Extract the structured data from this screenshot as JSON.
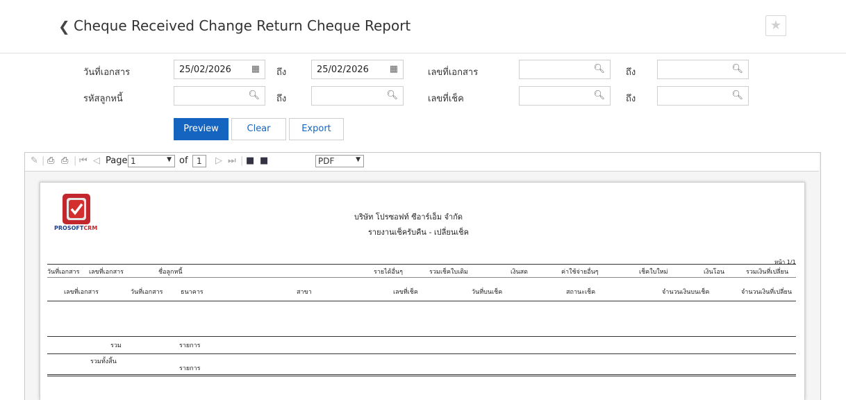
{
  "header": {
    "back_icon": "chevron-left-icon",
    "title": "Cheque Received Change Return Cheque Report",
    "star_icon": "star-icon"
  },
  "form": {
    "doc_date_label": "วันที่เอกสาร",
    "doc_date_from": "25/02/2026",
    "doc_date_to": "25/02/2026",
    "to_label": "ถึง",
    "doc_no_label": "เลขที่เอกสาร",
    "debtor_code_label": "รหัสลูกหนี้",
    "cheque_no_label": "เลขที่เช็ค",
    "calendar_icon": "calendar-icon",
    "search_icon": "search-icon"
  },
  "buttons": {
    "preview": "Preview",
    "clear": "Clear",
    "export": "Export"
  },
  "toolbar": {
    "page_label": "Page",
    "page_value": "1",
    "of_label": "of",
    "total_pages": "1",
    "format": "PDF"
  },
  "report": {
    "company": "บริษัท โปรซอฟท์ ซีอาร์เอ็ม จำกัด",
    "report_title": "รายงานเช็ครับคืน - เปลี่ยนเช็ค",
    "logo_text_a": "PROSOFT",
    "logo_text_b": "CRM",
    "page_info": "หน้า 1/1",
    "header1": [
      "วันที่เอกสาร",
      "เลขที่เอกสาร",
      "ชื่อลูกหนี้",
      "รายได้อื่นๆ",
      "รวมเช็คใบเดิม",
      "เงินสด",
      "ค่าใช้จ่ายอื่นๆ",
      "เช็คใบใหม่",
      "เงินโอน",
      "รวมเงินที่เปลี่ยน"
    ],
    "header2": [
      "เลขที่เอกสาร",
      "วันที่เอกสาร",
      "ธนาคาร",
      "สาขา",
      "เลขที่เช็ค",
      "วันที่บนเช็ค",
      "สถานะเช็ค",
      "จำนวนเงินบนเช็ค",
      "จำนวนเงินที่เปลี่ยน"
    ],
    "sum_label": "รวม",
    "sum_items": "รายการ",
    "grand_label": "รวมทั้งสิ้น",
    "grand_items": "รายการ"
  }
}
